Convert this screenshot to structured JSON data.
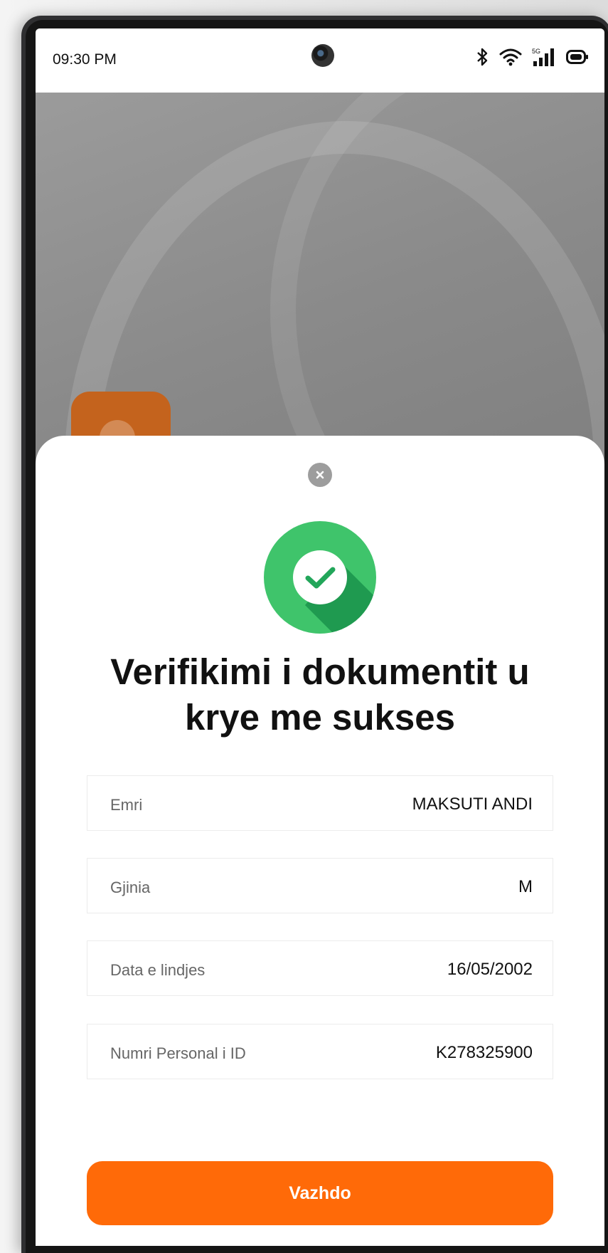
{
  "status_bar": {
    "time": "09:30 PM",
    "icons": [
      "bluetooth-icon",
      "wifi-icon",
      "5g-signal-icon",
      "battery-icon"
    ],
    "network_badge": "5G"
  },
  "app": {
    "icon": "orange-app-icon"
  },
  "sheet": {
    "close_icon": "close-icon",
    "success_icon": "check-icon",
    "title": "Verifikimi i dokumentit u kryre me sukses",
    "title_line1": "Verifikimi i dokumentit u",
    "title_line2": "krye me sukses",
    "fields": [
      {
        "label": "Emri",
        "value": "MAKSUTI ANDI"
      },
      {
        "label": "Gjinia",
        "value": "M"
      },
      {
        "label": "Data e lindjes",
        "value": "16/05/2002"
      },
      {
        "label": "Numri Personal i ID",
        "value": "K278325900"
      }
    ],
    "continue_label": "Vazhdo"
  },
  "colors": {
    "accent": "#ff6a08",
    "success": "#3fc46b",
    "success_dark": "#1f9a50"
  }
}
